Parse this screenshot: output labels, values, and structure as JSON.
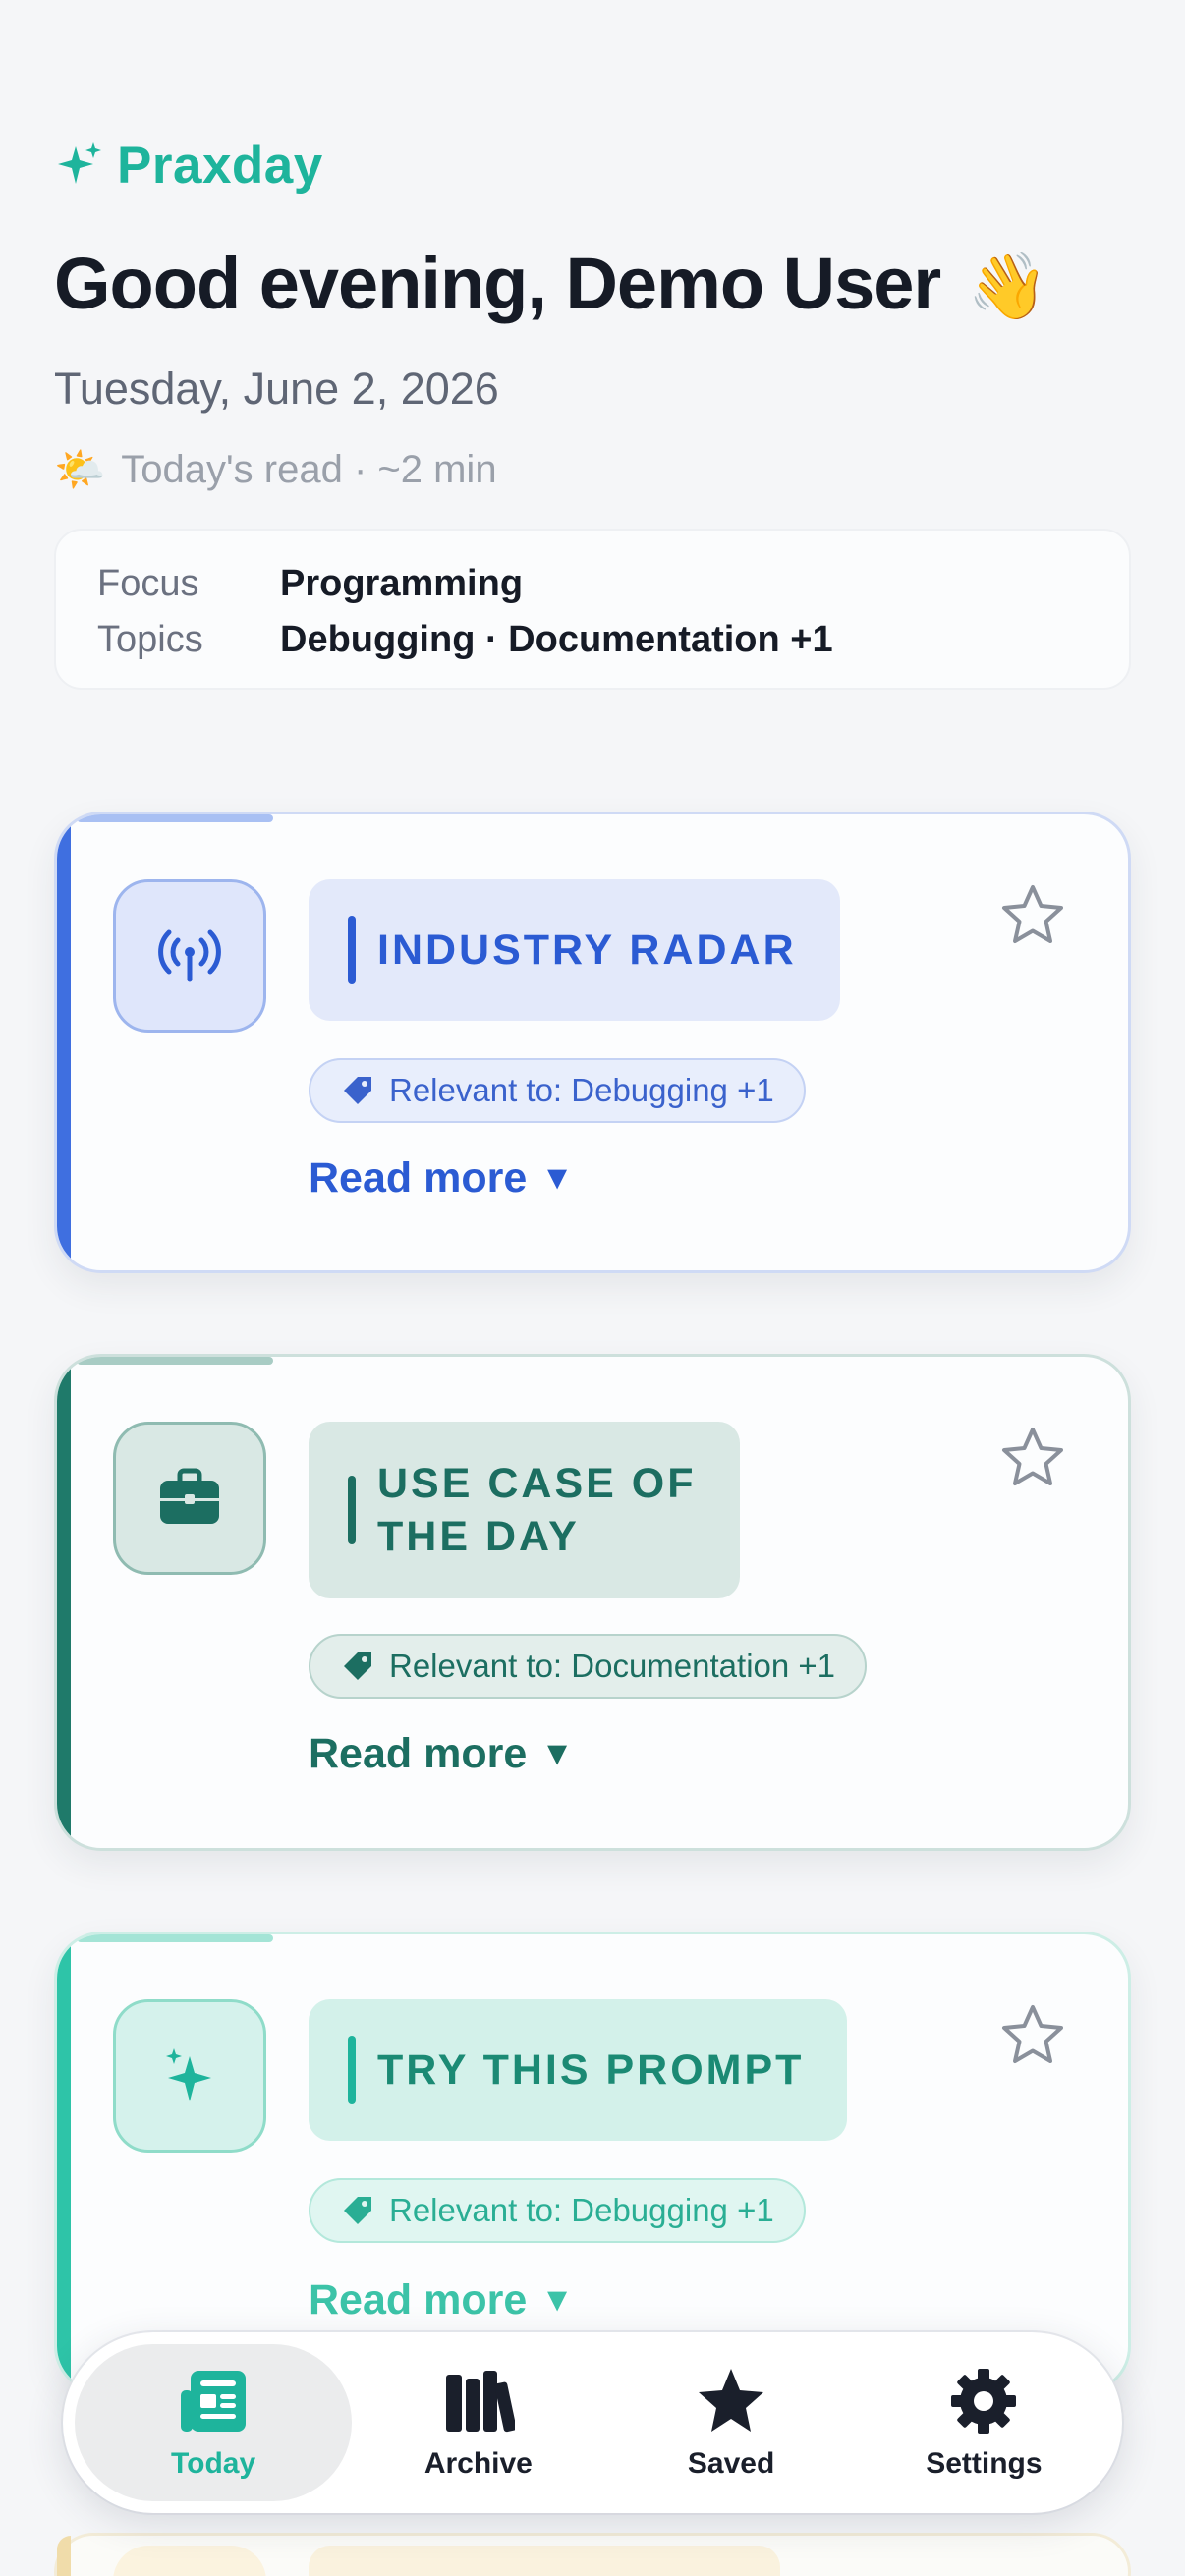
{
  "app": {
    "name": "Praxday",
    "brand_color": "#1eb49c"
  },
  "header": {
    "greeting": "Good evening, Demo User",
    "greeting_emoji": "👋",
    "date": "Tuesday, June 2, 2026",
    "read_emoji": "🌤️",
    "read_time": "Today's read · ~2 min"
  },
  "focus": {
    "focus_label": "Focus",
    "focus_value": "Programming",
    "topics_label": "Topics",
    "topics_value": "Debugging · Documentation +1"
  },
  "cards": [
    {
      "title": "INDUSTRY RADAR",
      "icon": "broadcast-icon",
      "tag": "Relevant to: Debugging +1",
      "read_more": "Read more",
      "accent": "#3f6fe0"
    },
    {
      "title_line1": "USE CASE OF",
      "title_line2": "THE DAY",
      "icon": "briefcase-icon",
      "tag": "Relevant to: Documentation +1",
      "read_more": "Read more",
      "accent": "#1f7a6a"
    },
    {
      "title": "TRY THIS PROMPT",
      "icon": "sparkle-icon",
      "tag": "Relevant to: Debugging +1",
      "read_more": "Read more",
      "accent": "#2ec4a8"
    }
  ],
  "nav": {
    "items": [
      {
        "label": "Today",
        "icon": "newspaper-icon",
        "active": true
      },
      {
        "label": "Archive",
        "icon": "books-icon",
        "active": false
      },
      {
        "label": "Saved",
        "icon": "star-icon",
        "active": false
      },
      {
        "label": "Settings",
        "icon": "gear-icon",
        "active": false
      }
    ]
  }
}
